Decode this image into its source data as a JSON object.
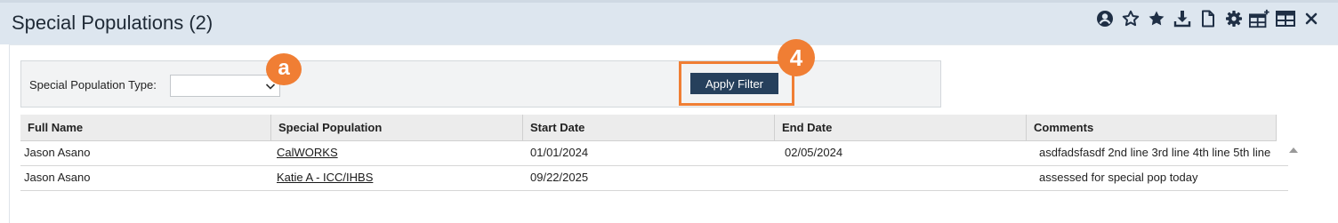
{
  "header": {
    "title": "Special Populations (2)",
    "toolbar_icons": [
      "user-circle-icon",
      "star-outline-icon",
      "star-icon",
      "download-icon",
      "document-icon",
      "gear-icon",
      "table-add-icon",
      "table-icon",
      "close-icon"
    ]
  },
  "filter": {
    "type_label": "Special Population Type:",
    "type_value": "",
    "apply_label": "Apply Filter"
  },
  "callouts": {
    "a": "a",
    "four": "4"
  },
  "table": {
    "columns": [
      "Full Name",
      "Special Population",
      "Start Date",
      "End Date",
      "Comments"
    ],
    "rows": [
      {
        "full_name": "Jason Asano",
        "special_population": "CalWORKS",
        "start_date": "01/01/2024",
        "end_date": "02/05/2024",
        "comments": "asdfadsfasdf 2nd line 3rd line 4th line 5th line"
      },
      {
        "full_name": "Jason Asano",
        "special_population": "Katie A - ICC/IHBS",
        "start_date": "09/22/2025",
        "end_date": "",
        "comments": "assessed for special pop today"
      }
    ]
  },
  "colors": {
    "header_bg": "#dde6ef",
    "button_bg": "#26405c",
    "callout": "#f07e34",
    "icon": "#1f2f45"
  }
}
